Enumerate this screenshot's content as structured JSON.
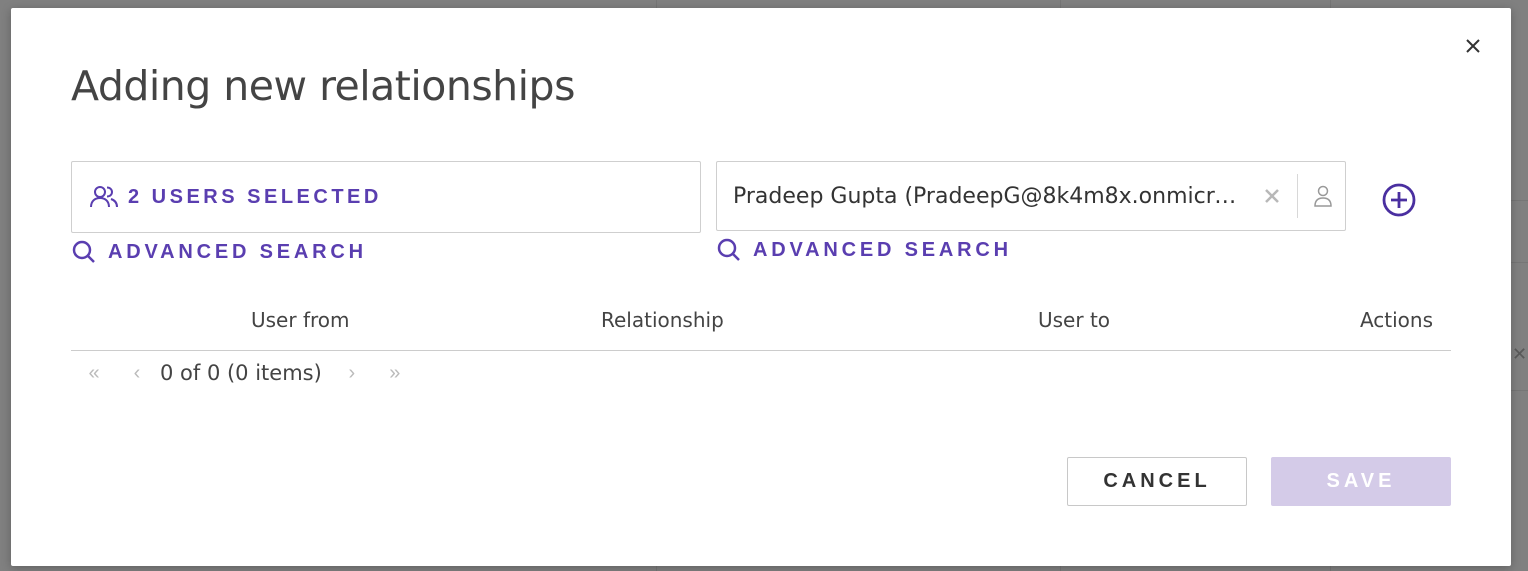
{
  "dialog": {
    "title": "Adding new relationships",
    "close_icon": "close-icon"
  },
  "from_selector": {
    "icon": "users-icon",
    "label": "2 USERS SELECTED",
    "advanced_search": "ADVANCED SEARCH"
  },
  "to_field": {
    "value": "Pradeep Gupta (PradeepG@8k4m8x.onmicrosoft.com)",
    "clear_icon": "clear-icon",
    "person_icon": "person-icon",
    "advanced_search": "ADVANCED SEARCH"
  },
  "add_icon": "plus-circle-icon",
  "table": {
    "columns": [
      "User from",
      "Relationship",
      "User to",
      "Actions"
    ],
    "rows": []
  },
  "pager": {
    "first": "«",
    "prev": "‹",
    "info": "0 of 0 (0 items)",
    "next": "›",
    "last": "»"
  },
  "buttons": {
    "cancel": "CANCEL",
    "save": "SAVE"
  },
  "colors": {
    "accent": "#5a3eb0",
    "save_disabled": "#d4cbe8",
    "overlay": "#808080"
  }
}
